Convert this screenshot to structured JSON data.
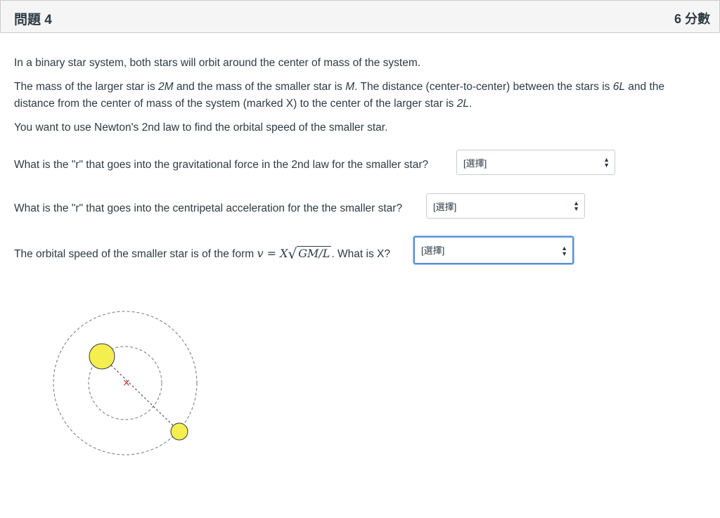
{
  "header": {
    "title": "問題 4",
    "points": "6 分數"
  },
  "body": {
    "p1": "In a binary star system, both stars will orbit around the center of mass of the system.",
    "p2": {
      "a": "The mass of the larger star is ",
      "m1": "2M",
      "b": " and the mass of the smaller star is ",
      "m2": "M",
      "c": ".  The distance (center-to-center) between the stars is ",
      "d1": "6L",
      "d": " and the distance from the center of mass of the system (marked X)  to the center of the larger star is ",
      "d2": "2L",
      "e": "."
    },
    "p3": "You want to use Newton's 2nd law to find the orbital speed of the smaller star."
  },
  "questions": [
    {
      "text": "What is the \"r\" that goes into the gravitational force in the 2nd law for the smaller star?",
      "select_value": "[選擇]"
    },
    {
      "text": "What is the \"r\" that goes into the centripetal acceleration for the the smaller star?",
      "select_value": "[選擇]"
    },
    {
      "text_pre": "The orbital speed of the smaller star is of the form ",
      "formula_lhs": "v = X",
      "formula_rad": "GM/L",
      "text_post": ". What is X?",
      "select_value": "[選擇]"
    }
  ],
  "diagram": {
    "center_marker": "×",
    "colors": {
      "star_fill": "#f5ee4f",
      "star_stroke": "#2d3b45",
      "orbit_stroke": "#6b7780",
      "cm_marker": "#d62b2b"
    }
  }
}
